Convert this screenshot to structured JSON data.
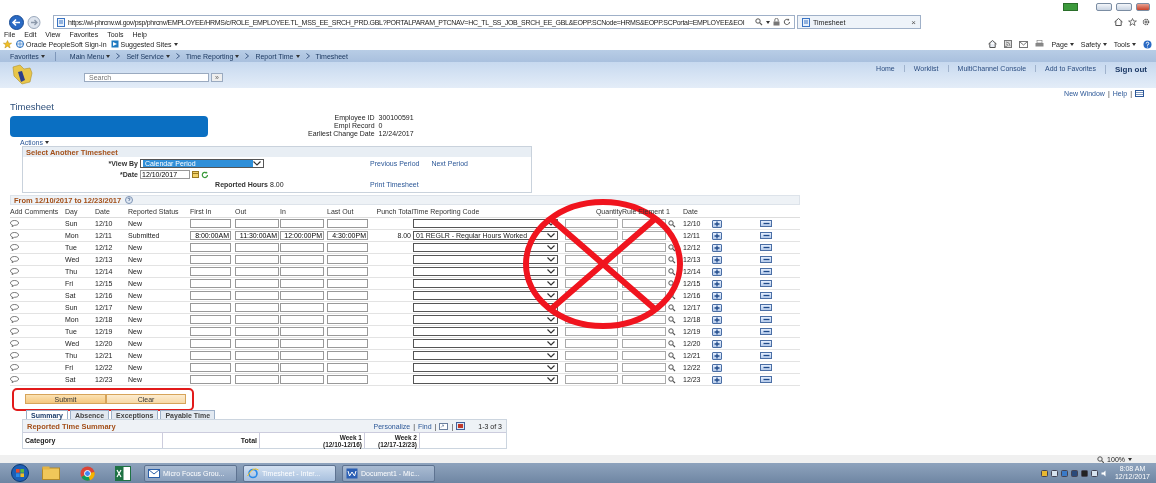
{
  "browser": {
    "url": "https://wi-phrcnv.wi.gov/psp/phrcnv/EMPLOYEE/HRMS/c/ROLE_EMPLOYEE.TL_MSS_EE_SRCH_PRD.GBL?PORTALPARAM_PTCNAV=HC_TL_SS_JOB_SRCH_EE_GBL&EOPP.SCNode=HRMS&EOPP.SCPortal=EMPLOYEE&EOI",
    "tab_title": "Timesheet",
    "close": "×",
    "menu": [
      "File",
      "Edit",
      "View",
      "Favorites",
      "Tools",
      "Help"
    ],
    "favorites": [
      {
        "label": "Oracle PeopleSoft Sign-in",
        "menu": false
      },
      {
        "label": "Suggested Sites",
        "menu": true
      }
    ],
    "commands": [
      "Page",
      "Safety",
      "Tools"
    ]
  },
  "nav": [
    {
      "label": "Favorites",
      "menu": true
    },
    {
      "label": "Main Menu",
      "menu": true
    },
    {
      "label": "Self Service",
      "menu": true
    },
    {
      "label": "Time Reporting",
      "menu": true
    },
    {
      "label": "Report Time",
      "menu": true
    },
    {
      "label": "Timesheet",
      "menu": false
    }
  ],
  "header": {
    "search_placeholder": "Search",
    "search_button": "»",
    "links": [
      "Home",
      "Worklist",
      "MultiChannel Console",
      "Add to Favorites",
      "Sign out"
    ]
  },
  "page_links": {
    "items": [
      "New Window",
      "Help"
    ],
    "separator": "|"
  },
  "title": "Timesheet",
  "employee": [
    {
      "label": "Employee ID",
      "value": "300100591"
    },
    {
      "label": "Empl Record",
      "value": "0"
    },
    {
      "label": "Earliest Change Date",
      "value": "12/24/2017"
    }
  ],
  "actions": "Actions",
  "select_panel": {
    "title": "Select Another Timesheet",
    "view_by_label": "*View By",
    "view_by": "Calendar Period",
    "date_label": "*Date",
    "date": "12/10/2017",
    "reported_hours_label": "Reported Hours",
    "reported_hours": "8.00",
    "period_links": [
      "Previous Period",
      "Next Period"
    ],
    "print": "Print Timesheet"
  },
  "timesheet": {
    "title": "From 12/10/2017 to 12/23/2017",
    "columns": [
      "Add Comments",
      "Day",
      "Date",
      "Reported Status",
      "First In",
      "Out",
      "In",
      "Last Out",
      "Punch Total",
      "Time Reporting Code",
      "Quantity",
      "Rule Element 1",
      "Date"
    ],
    "rows": [
      {
        "day": "Sun",
        "date": "12/10",
        "status": "New",
        "end_date": "12/10"
      },
      {
        "day": "Mon",
        "date": "12/11",
        "status": "Submitted",
        "first_in": "8:00:00AM",
        "out": "11:30:00AM",
        "in": "12:00:00PM",
        "last_out": "4:30:00PM",
        "punch_total": "8.00",
        "trc": "01 REGLR - Regular Hours Worked",
        "end_date": "12/11"
      },
      {
        "day": "Tue",
        "date": "12/12",
        "status": "New",
        "end_date": "12/12"
      },
      {
        "day": "Wed",
        "date": "12/13",
        "status": "New",
        "end_date": "12/13"
      },
      {
        "day": "Thu",
        "date": "12/14",
        "status": "New",
        "end_date": "12/14"
      },
      {
        "day": "Fri",
        "date": "12/15",
        "status": "New",
        "end_date": "12/15"
      },
      {
        "day": "Sat",
        "date": "12/16",
        "status": "New",
        "end_date": "12/16"
      },
      {
        "day": "Sun",
        "date": "12/17",
        "status": "New",
        "end_date": "12/17"
      },
      {
        "day": "Mon",
        "date": "12/18",
        "status": "New",
        "end_date": "12/18"
      },
      {
        "day": "Tue",
        "date": "12/19",
        "status": "New",
        "end_date": "12/19"
      },
      {
        "day": "Wed",
        "date": "12/20",
        "status": "New",
        "end_date": "12/20"
      },
      {
        "day": "Thu",
        "date": "12/21",
        "status": "New",
        "end_date": "12/21"
      },
      {
        "day": "Fri",
        "date": "12/22",
        "status": "New",
        "end_date": "12/22"
      },
      {
        "day": "Sat",
        "date": "12/23",
        "status": "New",
        "end_date": "12/23"
      }
    ]
  },
  "buttons": [
    "Submit",
    "Clear"
  ],
  "tabs": [
    {
      "label": "Summary",
      "selected": true
    },
    {
      "label": "Absence",
      "selected": false
    },
    {
      "label": "Exceptions",
      "selected": false
    },
    {
      "label": "Payable Time",
      "selected": false
    }
  ],
  "summary": {
    "title": "Reported Time Summary",
    "tools": [
      "Personalize",
      "Find"
    ],
    "separator": "|",
    "count": "1-3 of 3",
    "columns": [
      {
        "label": "Category"
      },
      {
        "label": "Total"
      },
      {
        "label": "Week 1",
        "range": "(12/10-12/16)"
      },
      {
        "label": "Week 2",
        "range": "(12/17-12/23)"
      }
    ]
  },
  "status_bar": {
    "zoom": "100%"
  },
  "taskbar": {
    "items": [
      {
        "label": "Micro Focus Grou...",
        "selected": false
      },
      {
        "label": "Timesheet - Inter...",
        "selected": true
      },
      {
        "label": "Document1 - Mic...",
        "selected": false
      }
    ],
    "time": "8:08 AM",
    "date": "12/12/2017"
  }
}
